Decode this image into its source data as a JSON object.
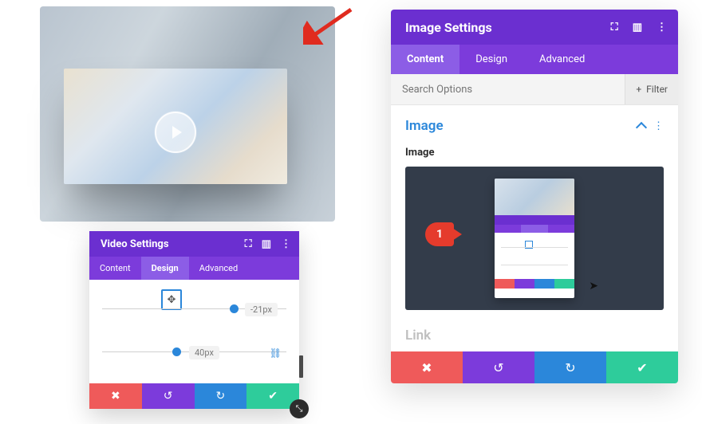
{
  "annotation": {
    "marker_label": "1"
  },
  "video_panel": {
    "title": "Video Settings",
    "tabs": {
      "content": "Content",
      "design": "Design",
      "advanced": "Advanced"
    },
    "active_tab": "Design",
    "slider_values": {
      "x_offset": "-21px",
      "y_offset": "40px"
    },
    "drag_glyph": "✥"
  },
  "image_panel": {
    "title": "Image Settings",
    "tabs": {
      "content": "Content",
      "design": "Design",
      "advanced": "Advanced"
    },
    "active_tab": "Content",
    "search_placeholder": "Search Options",
    "filter_label": "Filter",
    "section_title": "Image",
    "field_label": "Image",
    "link_section_title": "Link"
  },
  "action_buttons": {
    "close_glyph": "✖",
    "undo_glyph": "↺",
    "redo_glyph": "↻",
    "save_glyph": "✔"
  },
  "header_icons": {
    "expand_glyph": "⛶",
    "help_glyph": "▥",
    "kebab_glyph": "⋮"
  }
}
